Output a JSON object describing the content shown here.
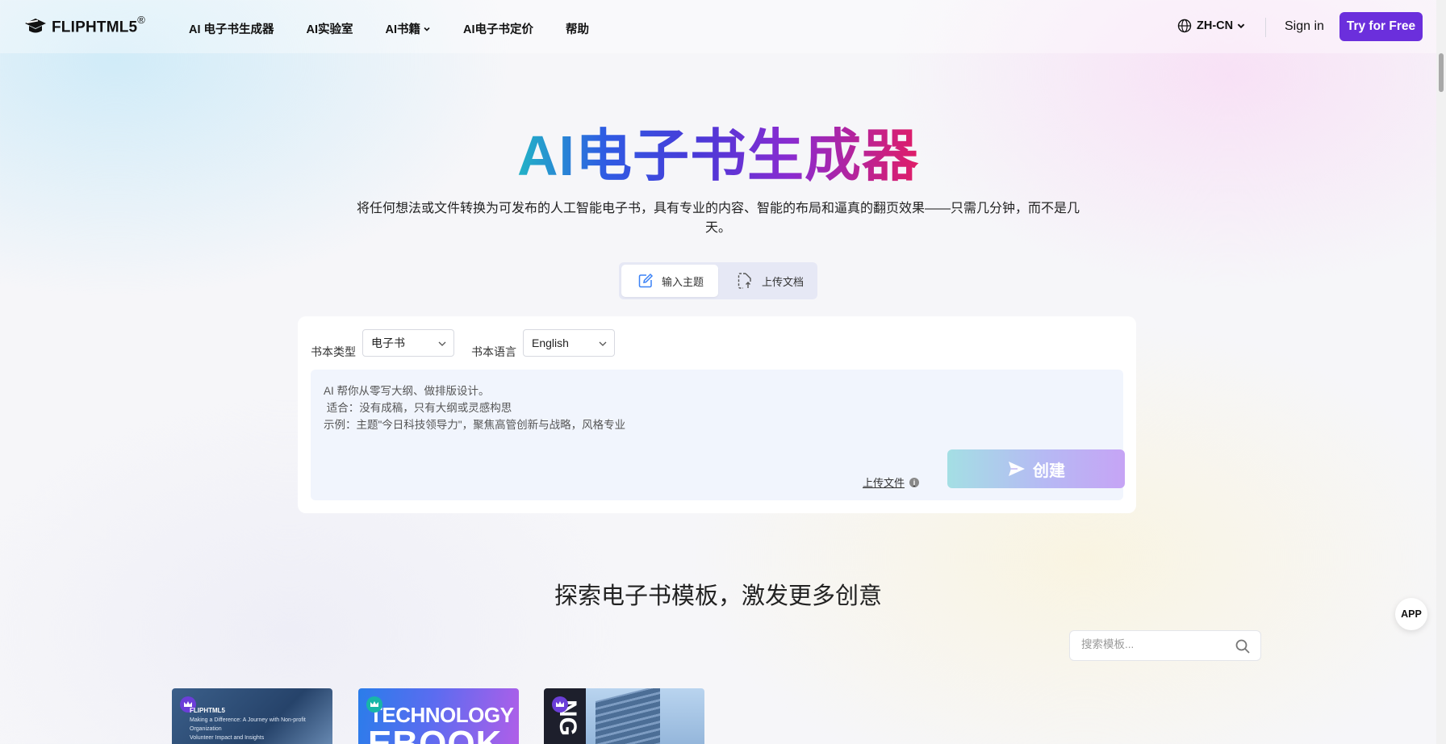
{
  "nav": {
    "logo_text": "FLIPHTML5",
    "logo_reg": "®",
    "menu": [
      {
        "label": "AI 电子书生成器"
      },
      {
        "label": "AI实验室"
      },
      {
        "label": "AI书籍"
      },
      {
        "label": "AI电子书定价"
      },
      {
        "label": "帮助"
      }
    ],
    "language": "ZH-CN",
    "signin": "Sign in",
    "try_free": "Try for Free"
  },
  "hero": {
    "title": "AI电子书生成器",
    "subtitle": "将任何想法或文件转换为可发布的人工智能电子书，具有专业的内容、智能的布局和逼真的翻页效果——只需几分钟，而不是几天。"
  },
  "mode_tabs": [
    {
      "label": "输入主题",
      "active": true
    },
    {
      "label": "上传文档",
      "active": false
    }
  ],
  "form": {
    "book_type_label": "书本类型",
    "book_type_value": "电子书",
    "book_lang_label": "书本语言",
    "book_lang_value": "English",
    "prompt_lines": [
      "AI 帮你从零写大纲、做排版设计。",
      " 适合：没有成稿，只有大纲或灵感构思",
      "示例：主题\"今日科技领导力\"，聚焦高管创新与战略，风格专业"
    ],
    "upload_link": "上传文件",
    "create_label": "创建"
  },
  "templates": {
    "section_title": "探索电子书模板，激发更多创意",
    "search_placeholder": "搜索模板...",
    "cards": [
      {
        "brand": "FLIPHTML5",
        "line1": "Making a Difference: A Journey with Non-profit Organization",
        "line2": "Volunteer Impact and Insights"
      },
      {
        "line1": "TECHNOLOGY",
        "line2": "EBOOK"
      },
      {
        "vertical": "NG"
      }
    ]
  },
  "app_badge": "APP",
  "colors": {
    "accent": "#6b2fdc",
    "title_gradient": [
      "#22b3c6",
      "#2f5be3",
      "#4a39d8",
      "#8a2bd0",
      "#e01d67"
    ]
  }
}
